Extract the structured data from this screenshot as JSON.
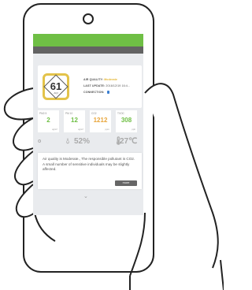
{
  "colors": {
    "header": "#6fbf45",
    "subheader": "#636363",
    "moderate": "#e3c34a",
    "pm25": "#6fbf45",
    "pm10": "#6fbf45",
    "co2": "#e8a53a",
    "tvoc": "#6fbf45"
  },
  "aqi": {
    "value": "61",
    "unit": "AQI",
    "quality_label": "AIR QUALITY:",
    "quality_value": "Moderate",
    "update_label": "LAST UPDATE:",
    "update_value": "2016/12/19 16:4...",
    "connection_label": "CONNECTION:",
    "connection_icon": "bluetooth-icon"
  },
  "metrics": [
    {
      "label": "PM2.5",
      "value": "2",
      "unit": "ug/m³"
    },
    {
      "label": "PM 10",
      "value": "12",
      "unit": "ug/m³"
    },
    {
      "label": "CO2",
      "value": "1212",
      "unit": "ppm"
    },
    {
      "label": "TVOC",
      "value": "308",
      "unit": "ppb"
    }
  ],
  "environment": {
    "sensor_icon": "dot-icon",
    "humidity_icon": "droplet-icon",
    "humidity": "52%",
    "temperature_icon": "thermometer-icon",
    "temperature": "27℃"
  },
  "message": {
    "line1": "Air quality is Moderate., The responsible pollutant is CO2.",
    "line2": "A small number of sensitive individuals may be slightly affected.",
    "more_label": "more"
  },
  "expand_icon": "double-chevron-down-icon"
}
